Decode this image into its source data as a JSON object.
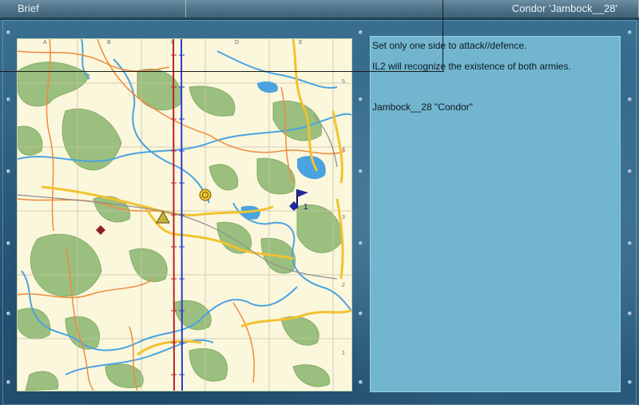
{
  "header": {
    "left_tab": "Brief",
    "right_tab": "Condor 'Jambock__28'"
  },
  "brief": {
    "line1": "Set only one side to attack//defence.",
    "line2": "IL2 will recognize the existence of both armies.",
    "line3": "Jambock__28 \"Condor\""
  },
  "map": {
    "column_labels": [
      "A",
      "B",
      "C",
      "D",
      "E"
    ],
    "row_labels": [
      "5",
      "4",
      "3",
      "2",
      "1"
    ],
    "marker_label": "1"
  },
  "colors": {
    "map_background": "#fbf7dc",
    "forest": "#9bbf7e",
    "river": "#4aa3e0",
    "road_major": "#f2c230",
    "road_minor": "#ef8a3c",
    "front_red": "#c0202a",
    "front_blue": "#2a3ad0",
    "brief_panel": "#72b5cf"
  },
  "icons": [
    "rivet-icon",
    "target-icon",
    "airfield-icon",
    "enemy-diamond-icon",
    "flag-icon"
  ]
}
